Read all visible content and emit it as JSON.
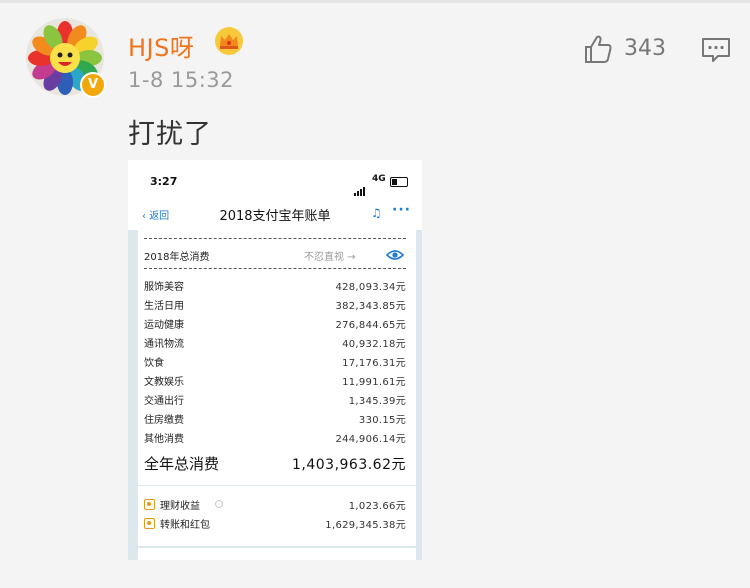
{
  "post": {
    "username": "HJS呀",
    "timestamp": "1-8 15:32",
    "text": "打扰了",
    "likes": "343"
  },
  "icons": {
    "like": "thumbs-up-icon",
    "comment": "comment-icon",
    "crown": "crown-badge-icon",
    "verified": "verified-badge-icon",
    "eye": "eye-icon"
  },
  "colors": {
    "username": "#f0731e",
    "verified": "#f2a80d",
    "link": "#1e7bd6"
  },
  "screenshot": {
    "status_time": "3:27",
    "status_network": "4G",
    "nav_back": "返回",
    "nav_title": "2018支付宝年账单",
    "total_label": "2018年总消费",
    "total_hint": "不忍直视 →",
    "categories": [
      {
        "name": "服饰美容",
        "amount": "428,093.34元"
      },
      {
        "name": "生活日用",
        "amount": "382,343.85元"
      },
      {
        "name": "运动健康",
        "amount": "276,844.65元"
      },
      {
        "name": "通讯物流",
        "amount": "40,932.18元"
      },
      {
        "name": "饮食",
        "amount": "17,176.31元"
      },
      {
        "name": "文教娱乐",
        "amount": "11,991.61元"
      },
      {
        "name": "交通出行",
        "amount": "1,345.39元"
      },
      {
        "name": "住房缴费",
        "amount": "330.15元"
      },
      {
        "name": "其他消费",
        "amount": "244,906.14元"
      }
    ],
    "year_total_label": "全年总消费",
    "year_total_amount": "1,403,963.62元",
    "extras": [
      {
        "label": "理财收益",
        "amount": "1,023.66元"
      },
      {
        "label": "转账和红包",
        "amount": "1,629,345.38元"
      }
    ]
  }
}
